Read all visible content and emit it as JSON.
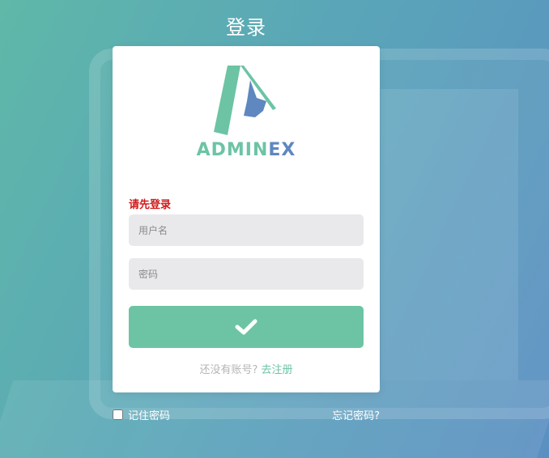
{
  "page": {
    "title": "登录"
  },
  "logo": {
    "brand_part1": "ADMIN",
    "brand_part2": "EX",
    "colors": {
      "green": "#6cc4a4",
      "blue": "#5f87c0"
    }
  },
  "form": {
    "error_message": "请先登录",
    "username_placeholder": "用户名",
    "password_placeholder": "密码",
    "submit_icon": "checkmark-icon",
    "register_prompt": "还没有账号?",
    "register_link": "去注册"
  },
  "footer": {
    "remember_label": "记住密码",
    "remember_checked": false,
    "forgot_link": "忘记密码?"
  },
  "colors": {
    "accent": "#6cc4a4",
    "error": "#d11a1a",
    "input_bg": "#e9e9ec"
  }
}
